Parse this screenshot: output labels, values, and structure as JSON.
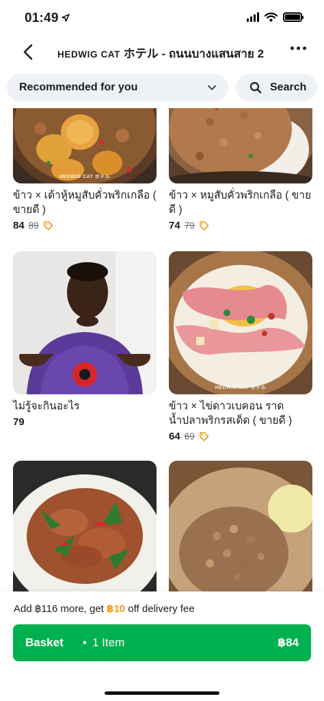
{
  "status": {
    "time": "01:49"
  },
  "header": {
    "title_latin": "HEDWIG CAT",
    "title_rest": "ホテル - ถนนบางแสนสาย 2"
  },
  "filter": {
    "dropdown_label": "Recommended for you",
    "search_label": "Search"
  },
  "items": [
    {
      "name": "ข้าว × เต้าหู้หมูสับคั่วพริกเกลือ ( ขายดี )",
      "price": "84",
      "old_price": "89",
      "watermark": "HEDWIG CAT ホテル"
    },
    {
      "name": "ข้าว × หมูสับคั่วพริกเกลือ ( ขายดี )",
      "price": "74",
      "old_price": "79",
      "watermark": ""
    },
    {
      "name": "ไม่รู้จะกินอะไร",
      "price": "79",
      "old_price": "",
      "watermark": ""
    },
    {
      "name": "ข้าว × ไข่ดาวเบคอน ราดน้ำปลาพริกรสเด็ด ( ขายดี )",
      "price": "64",
      "old_price": "69",
      "watermark": "HEDWIG CAT ホテル"
    },
    {
      "name": "",
      "price": "",
      "old_price": "",
      "watermark": ""
    },
    {
      "name": "",
      "price": "",
      "old_price": "",
      "watermark": ""
    }
  ],
  "promo": {
    "prefix": "Add ฿116 more, get ",
    "highlight": "฿10",
    "suffix": " off delivery fee"
  },
  "basket": {
    "label": "Basket",
    "dot": "•",
    "count": "1 Item",
    "total": "฿84"
  },
  "colors": {
    "accent_green": "#00b14f",
    "promo_orange": "#f39c12",
    "tag_orange": "#f39c12",
    "chip_bg": "#eef1f5"
  }
}
